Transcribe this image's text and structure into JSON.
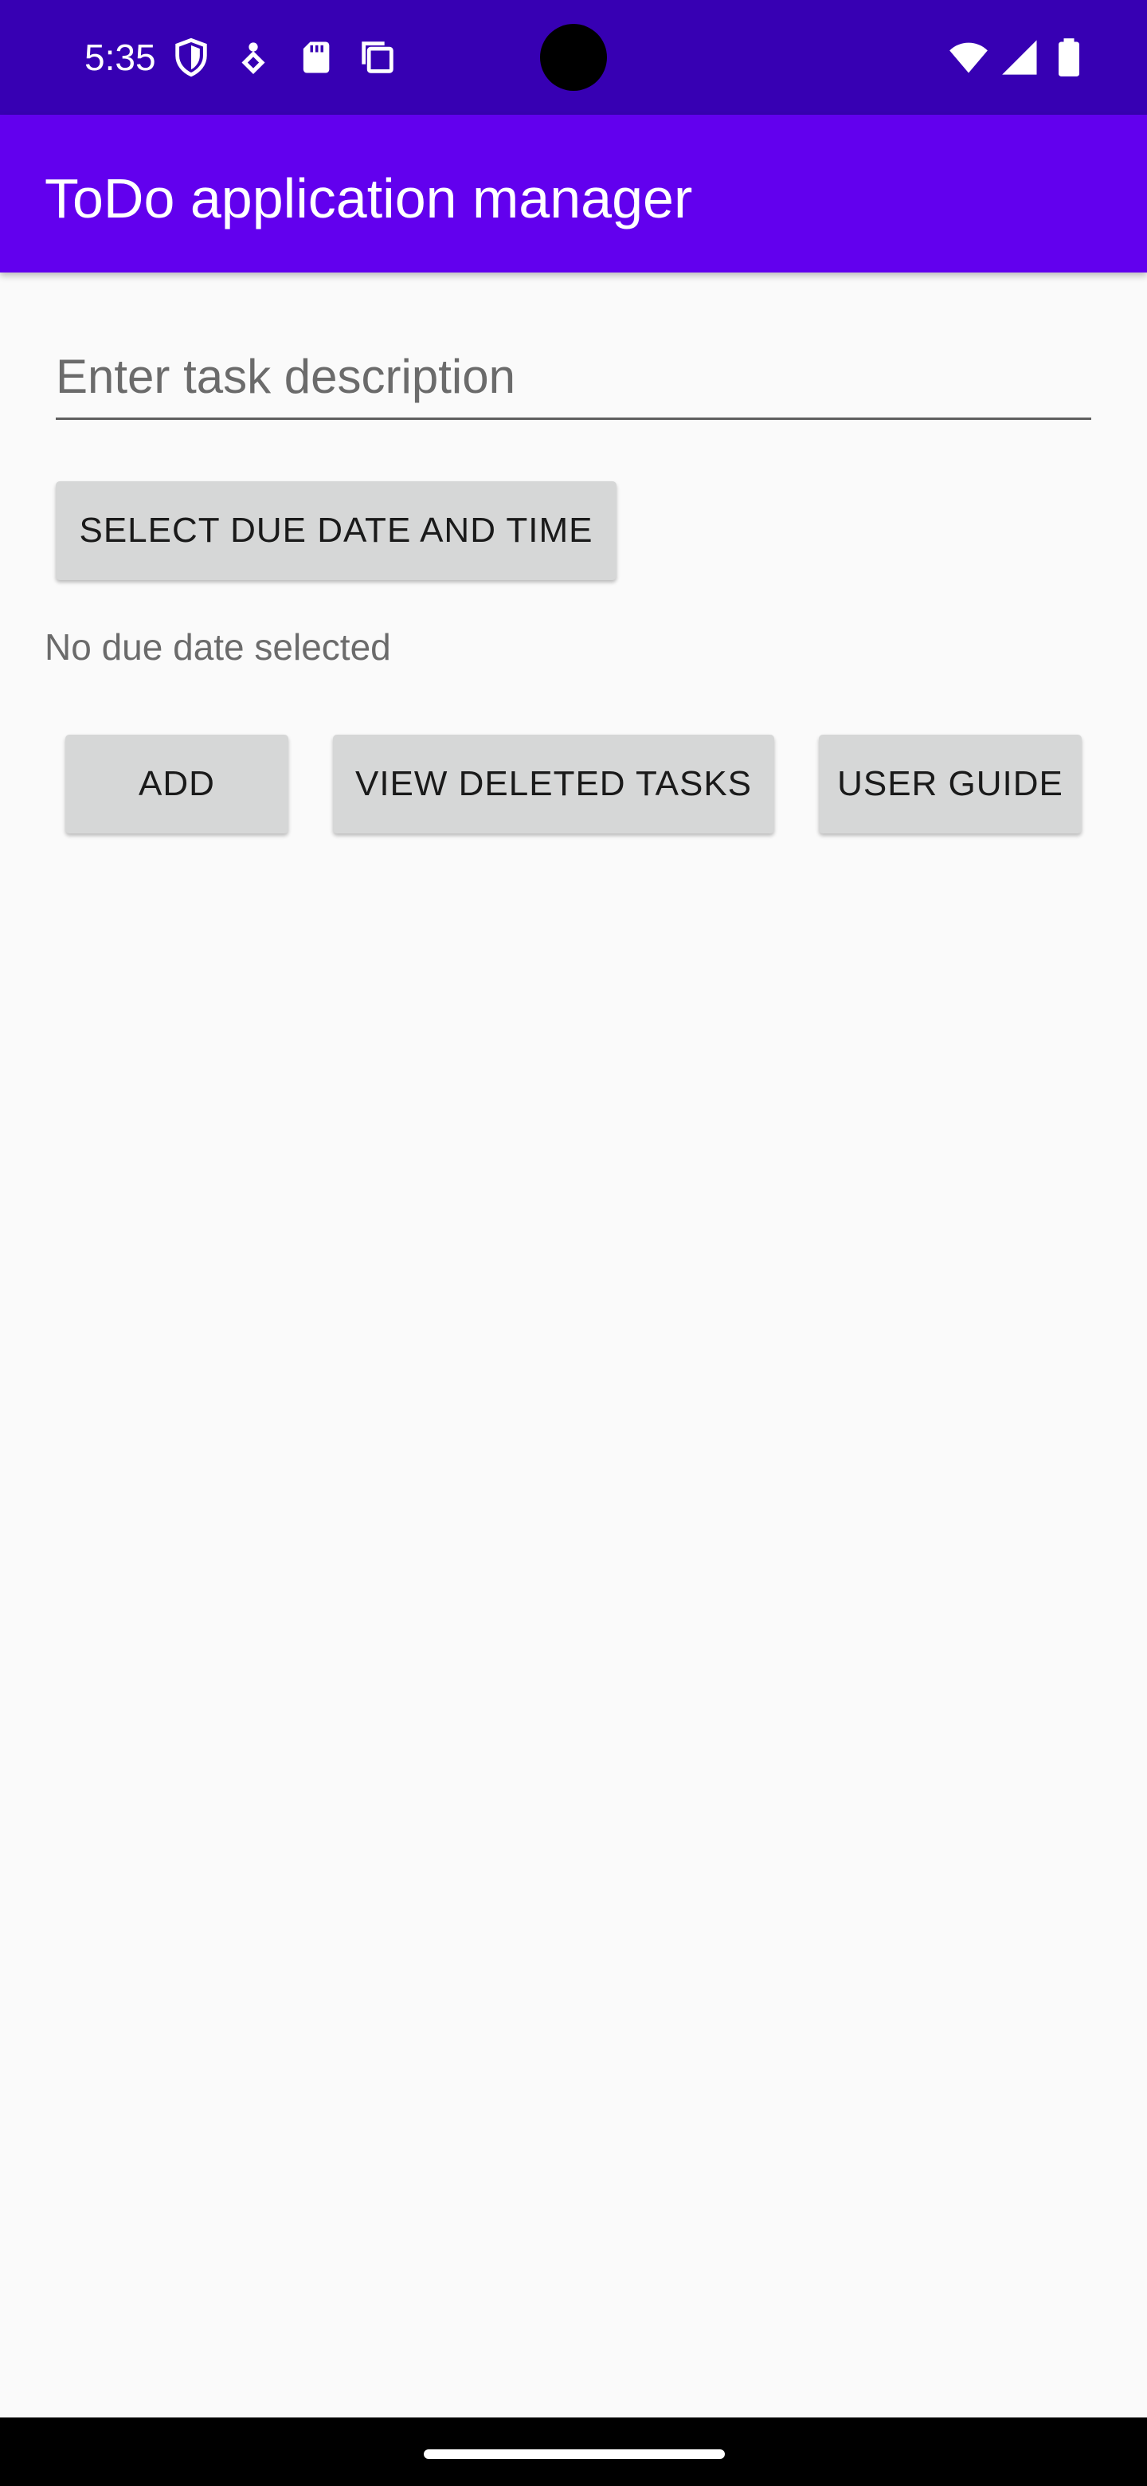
{
  "status_bar": {
    "time": "5:35",
    "left_icons": [
      "shield-icon",
      "alert-icon",
      "sd-card-icon",
      "copy-icon"
    ],
    "right_icons": [
      "wifi-icon",
      "cellular-signal-icon",
      "battery-icon"
    ],
    "bg_color": "#3700b3"
  },
  "app_bar": {
    "title": "ToDo application manager",
    "bg_color": "#6200ee"
  },
  "form": {
    "task_placeholder": "Enter task description",
    "task_value": "",
    "select_due_label": "SELECT DUE DATE AND TIME",
    "due_status": "No due date selected"
  },
  "actions": {
    "add_label": "ADD",
    "view_deleted_label": "VIEW DELETED TASKS",
    "user_guide_label": "USER GUIDE"
  }
}
